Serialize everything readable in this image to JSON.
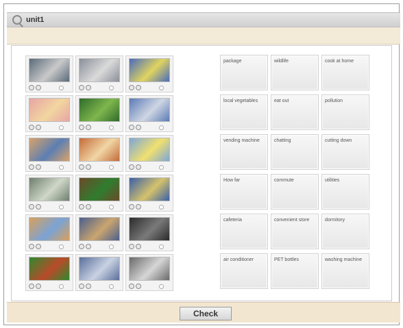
{
  "window": {
    "title": "unit1",
    "icon": "search-icon",
    "check_label": "Check"
  },
  "image_cards": [
    {
      "icon": "store-shelves-photo",
      "colors": [
        "#5a6b7a",
        "#c9c9c9"
      ]
    },
    {
      "icon": "shop-exterior-photo",
      "colors": [
        "#8a8f99",
        "#dadada"
      ]
    },
    {
      "icon": "person-recycling-clipart",
      "colors": [
        "#4a6bbd",
        "#e0d45f"
      ]
    },
    {
      "icon": "people-eating-clipart",
      "colors": [
        "#e8a4a4",
        "#f2d6a0"
      ]
    },
    {
      "icon": "green-leaves-photo",
      "colors": [
        "#2f6b2a",
        "#7fb64d"
      ]
    },
    {
      "icon": "car-clipart",
      "colors": [
        "#5b7bb6",
        "#cfd6e3"
      ]
    },
    {
      "icon": "group-chatting-clipart",
      "colors": [
        "#d8a26a",
        "#5c7fb3"
      ]
    },
    {
      "icon": "family-clipart",
      "colors": [
        "#c46b3a",
        "#f1d6a5"
      ]
    },
    {
      "icon": "air-conditioner-clipart",
      "colors": [
        "#7ea6d6",
        "#f0e070"
      ]
    },
    {
      "icon": "tall-building-clipart",
      "colors": [
        "#6f7f6f",
        "#d0d8c8"
      ]
    },
    {
      "icon": "wildlife-clipart",
      "colors": [
        "#6b4a2a",
        "#2f7d2f"
      ]
    },
    {
      "icon": "utilities-clipart",
      "colors": [
        "#3b5fa8",
        "#d4c26b"
      ]
    },
    {
      "icon": "cafeteria-clipart",
      "colors": [
        "#d9a05b",
        "#7aa3d6"
      ]
    },
    {
      "icon": "meeting-clipart",
      "colors": [
        "#4b5f8c",
        "#caa56f"
      ]
    },
    {
      "icon": "city-night-photo",
      "colors": [
        "#2b2b2b",
        "#7a7a7a"
      ]
    },
    {
      "icon": "dormitory-clipart",
      "colors": [
        "#2e8a2e",
        "#b94a2a"
      ]
    },
    {
      "icon": "pet-bottles-photo",
      "colors": [
        "#5a6f9a",
        "#c9d2e3"
      ]
    },
    {
      "icon": "vending-machine-photo",
      "colors": [
        "#6a6a6a",
        "#d6d6d6"
      ]
    }
  ],
  "word_cards": [
    "package",
    "wildlife",
    "cook at home",
    "local vegetables",
    "eat out",
    "pollution",
    "vending machine",
    "chatting",
    "cutting down",
    "How far",
    "commute",
    "utilities",
    "cafeteria",
    "convenient store",
    "dormitory",
    "air conditioner",
    "PET bottles",
    "washing machine"
  ]
}
